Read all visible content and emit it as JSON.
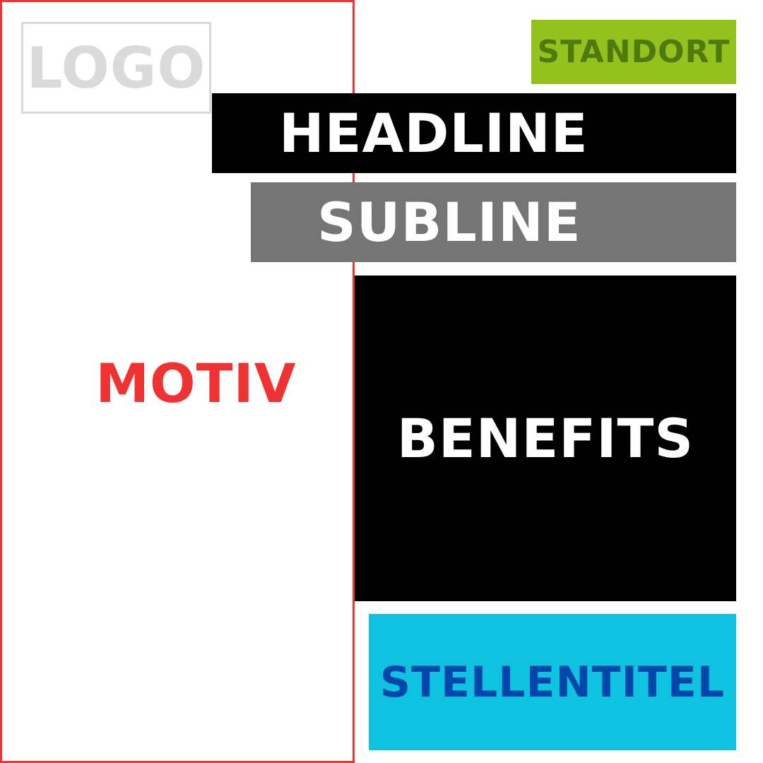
{
  "logo": {
    "label": "LOGO",
    "text_color": "#dadada",
    "border_color": "#dadada"
  },
  "standort": {
    "label": "STANDORT",
    "bg_color": "#95c11f",
    "text_color": "#4f7a0e"
  },
  "headline": {
    "label": "HEADLINE",
    "bg_color": "#000000",
    "text_color": "#ffffff"
  },
  "subline": {
    "label": "SUBLINE",
    "bg_color": "#757575",
    "text_color": "#ffffff"
  },
  "motiv": {
    "label": "MOTIV",
    "text_color": "#f03232",
    "border_color": "#f03232"
  },
  "benefits": {
    "label": "BENEFITS",
    "bg_color": "#000000",
    "text_color": "#ffffff"
  },
  "stellentitel": {
    "label": "STELLENTITEL",
    "bg_color": "#0ec2e0",
    "text_color": "#0047ab"
  }
}
